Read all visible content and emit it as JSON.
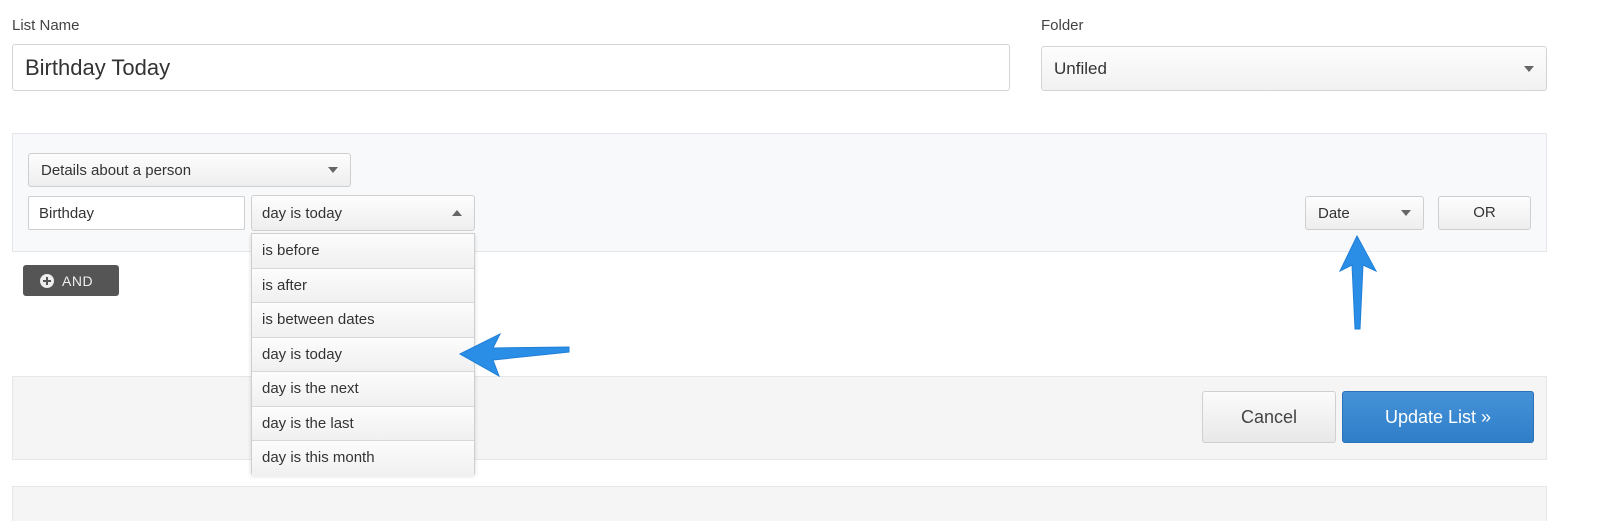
{
  "list_name": {
    "label": "List Name",
    "value": "Birthday Today"
  },
  "folder": {
    "label": "Folder",
    "value": "Unfiled"
  },
  "criteria": {
    "category_select": "Details about a person",
    "field_input": "Birthday",
    "operator_select": "day is today",
    "type_select": "Date",
    "or_button": "OR"
  },
  "and_button": "AND",
  "operator_options": [
    "is before",
    "is after",
    "is between dates",
    "day is today",
    "day is the next",
    "day is the last",
    "day is this month"
  ],
  "footer": {
    "cancel": "Cancel",
    "update": "Update List »"
  },
  "colors": {
    "primary": "#3a87cf",
    "annotation_arrow": "#2b8ee6",
    "and_button": "#555555"
  },
  "annotations": [
    "left-pointing arrow at 'day is today' option",
    "up-pointing arrow at 'Date' select"
  ]
}
